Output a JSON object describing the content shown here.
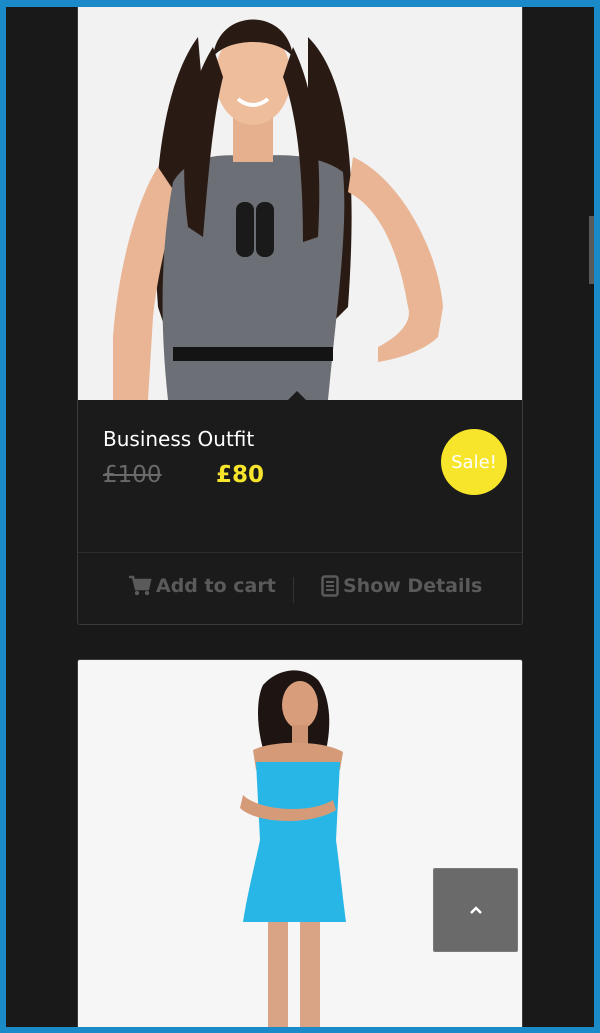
{
  "products": [
    {
      "name": "Business Outfit",
      "old_price": "£100",
      "new_price": "£80",
      "badge": "Sale!",
      "image_alt": "Woman in grey business dress"
    },
    {
      "image_alt": "Woman in blue strapless dress"
    }
  ],
  "actions": {
    "add_to_cart": "Add to cart",
    "show_details": "Show Details"
  },
  "colors": {
    "accent_yellow": "#f7e52b",
    "frame_blue": "#1a8ac9",
    "background": "#191919"
  },
  "icons": [
    "cart-icon",
    "document-icon",
    "chevron-up-icon"
  ]
}
